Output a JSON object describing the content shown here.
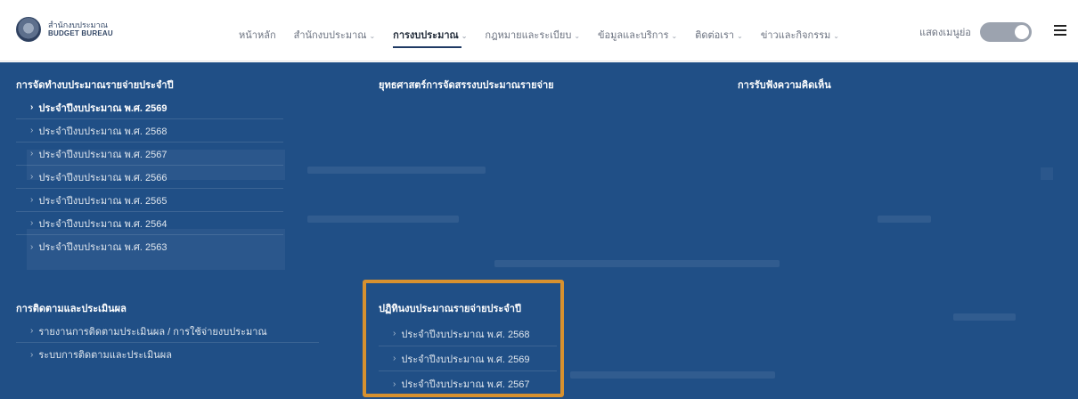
{
  "brand": {
    "name_th": "สำนักงบประมาณ",
    "name_en": "BUDGET BUREAU"
  },
  "nav": {
    "items": [
      {
        "label": "หน้าหลัก",
        "has_dropdown": false
      },
      {
        "label": "สำนักงบประมาณ",
        "has_dropdown": true
      },
      {
        "label": "การงบประมาณ",
        "has_dropdown": true,
        "active": true
      },
      {
        "label": "กฎหมายและระเบียบ",
        "has_dropdown": true
      },
      {
        "label": "ข้อมูลและบริการ",
        "has_dropdown": true
      },
      {
        "label": "ติดต่อเรา",
        "has_dropdown": true
      },
      {
        "label": "ข่าวและกิจกรรม",
        "has_dropdown": true
      }
    ],
    "chevron": "⌄"
  },
  "toggle": {
    "label": "แสดงเมนูย่อ",
    "state": "on"
  },
  "mega_menu": {
    "arrow": "›",
    "columns": [
      {
        "title": "การจัดทำงบประมาณรายจ่ายประจำปี",
        "items": [
          "ประจำปีงบประมาณ พ.ศ. 2569",
          "ประจำปีงบประมาณ พ.ศ. 2568",
          "ประจำปีงบประมาณ พ.ศ. 2567",
          "ประจำปีงบประมาณ พ.ศ. 2566",
          "ประจำปีงบประมาณ พ.ศ. 2565",
          "ประจำปีงบประมาณ พ.ศ. 2564",
          "ประจำปีงบประมาณ พ.ศ. 2563"
        ]
      },
      {
        "title": "ยุทธศาสตร์การจัดสรรงบประมาณรายจ่าย",
        "items": []
      },
      {
        "title": "การรับฟังความคิดเห็น",
        "items": []
      },
      {
        "title": "การติดตามและประเมินผล",
        "items": [
          "รายงานการติดตามประเมินผล / การใช้จ่ายงบประมาณ",
          "ระบบการติดตามและประเมินผล"
        ]
      },
      {
        "title": "ปฏิทินงบประมาณรายจ่ายประจำปี",
        "items": [
          "ประจำปีงบประมาณ พ.ศ. 2568",
          "ประจำปีงบประมาณ พ.ศ. 2569",
          "ประจำปีงบประมาณ พ.ศ. 2567"
        ]
      }
    ]
  },
  "colors": {
    "menu_bg": "#204f86",
    "highlight": "#d7912f",
    "header_bg": "#ffffff"
  }
}
